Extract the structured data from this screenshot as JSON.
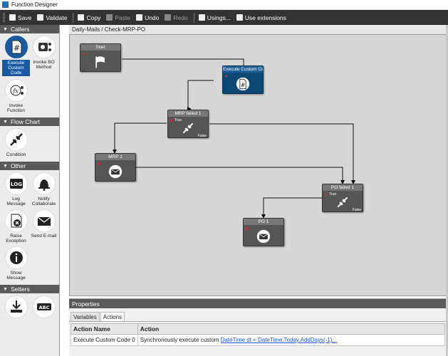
{
  "window": {
    "title": "Function Designer"
  },
  "toolbar": {
    "save": "Save",
    "validate": "Validate",
    "copy": "Copy",
    "paste": "Paste",
    "undo": "Undo",
    "redo": "Redo",
    "usings": "Usings...",
    "use_extensions": "Use extensions"
  },
  "sidebar": {
    "callers": {
      "header": "Callers",
      "items": [
        "Execute Custom Code",
        "Invoke BO Method",
        "Invoke Function"
      ]
    },
    "flow_chart": {
      "header": "Flow Chart",
      "items": [
        "Condition"
      ]
    },
    "other": {
      "header": "Other",
      "items": [
        "Log Message",
        "Notify Collaborate",
        "Raise Exception",
        "Send E-mail",
        "Show Message"
      ]
    },
    "setters": {
      "header": "Setters"
    }
  },
  "designer": {
    "breadcrumb": "Daily-Mails / Check-MRP-PO",
    "nodes": {
      "start": "Start",
      "exec": "Execute Custom Co",
      "mrp_failed": "MRP failed 1",
      "mrp": "MRP 1",
      "po_failed": "PO failed 1",
      "po": "PO 1"
    },
    "true_label": "True",
    "false_label": "False"
  },
  "properties": {
    "title": "Properties",
    "tabs": [
      "Variables",
      "Actions"
    ],
    "columns": [
      "Action Name",
      "Action"
    ],
    "rows": [
      {
        "name": "Execute Custom Code 0",
        "action_text": "Synchronously execute custom ",
        "action_code": "DateTime dt = DateTime.Today.AddDays(-1)..."
      }
    ]
  }
}
